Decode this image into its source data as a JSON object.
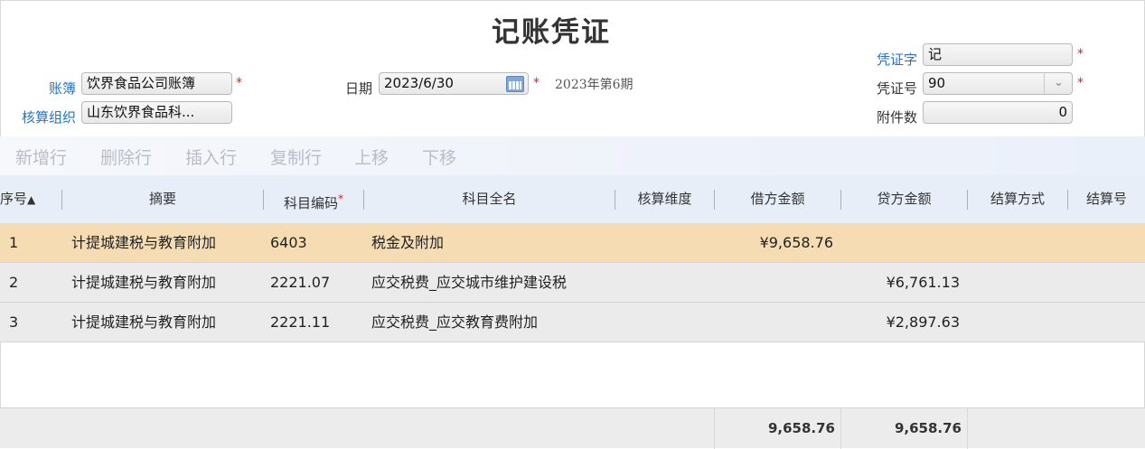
{
  "title": "记账凭证",
  "header": {
    "ledger_label": "账簿",
    "ledger_value": "饮界食品公司账簿",
    "org_label": "核算组织",
    "org_value": "山东饮界食品科...",
    "date_label": "日期",
    "date_value": "2023/6/30",
    "period_text": "2023年第6期",
    "voucher_word_label": "凭证字",
    "voucher_word_value": "记",
    "voucher_no_label": "凭证号",
    "voucher_no_value": "90",
    "attachments_label": "附件数",
    "attachments_value": "0",
    "required_mark": "*"
  },
  "toolbar": {
    "add_row": "新增行",
    "delete_row": "删除行",
    "insert_row": "插入行",
    "copy_row": "复制行",
    "move_up": "上移",
    "move_down": "下移"
  },
  "columns": {
    "seq": "序号",
    "summary": "摘要",
    "account_code": "科目编码",
    "account_name": "科目全名",
    "dimension": "核算维度",
    "debit": "借方金额",
    "credit": "贷方金额",
    "settle_method": "结算方式",
    "settle_no": "结算号",
    "sort_asc": "▲"
  },
  "rows": [
    {
      "seq": "1",
      "summary": "计提城建税与教育附加",
      "code": "6403",
      "name": "税金及附加",
      "debit": "¥9,658.76",
      "credit": ""
    },
    {
      "seq": "2",
      "summary": "计提城建税与教育附加",
      "code": "2221.07",
      "name": "应交税费_应交城市维护建设税",
      "debit": "",
      "credit": "¥6,761.13"
    },
    {
      "seq": "3",
      "summary": "计提城建税与教育附加",
      "code": "2221.11",
      "name": "应交税费_应交教育费附加",
      "debit": "",
      "credit": "¥2,897.63"
    }
  ],
  "totals": {
    "debit": "9,658.76",
    "credit": "9,658.76"
  },
  "icons": {
    "calendar": "calendar-icon",
    "dropdown": "chevron-down-icon",
    "sort": "sort-asc-icon"
  },
  "colors": {
    "selected_row": "#f6dcb3",
    "link_label": "#1f74c9",
    "required": "#e02020"
  }
}
